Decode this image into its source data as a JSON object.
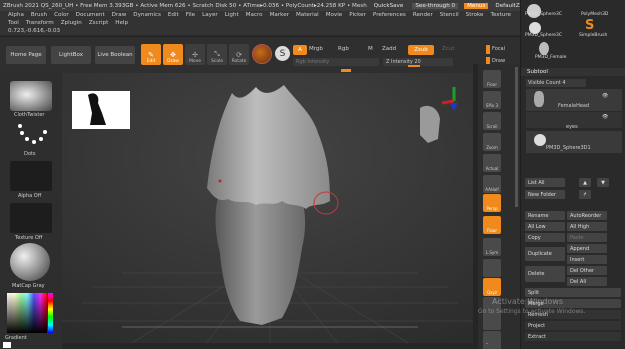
{
  "window": {
    "title": "ZBrush 2021   QS_260_UH  • Free Mem 3.393GB • Active Mem 626 • Scratch Disk 50 • ATime▸0.036 • PolyCount▸24.258 KP • Mesh",
    "quicksave": "QuickSave",
    "see_through": "See-through  0",
    "menus_label": "Menus",
    "default_script": "DefaultZScript"
  },
  "menu": {
    "row1": [
      "Alpha",
      "Brush",
      "Color",
      "Document",
      "Draw",
      "Dynamics",
      "Edit",
      "File",
      "Layer",
      "Light",
      "Macro",
      "Marker",
      "Material",
      "Movie",
      "Picker",
      "Preferences",
      "Render",
      "Stencil",
      "Stroke",
      "Texture"
    ],
    "row2": [
      "Tool",
      "Transform",
      "Zplugin",
      "Zscript",
      "Help"
    ],
    "coords": "0.723,-0.616,-0.03"
  },
  "toolbar": {
    "home_page": "Home Page",
    "lightbox": "LightBox",
    "live_boolean": "Live Boolean",
    "edit": "Edit",
    "draw": "Draw",
    "move": "Move",
    "scale": "Scale",
    "rotate": "Rotate",
    "a_label": "A",
    "mrgb": "Mrgb",
    "rgb": "Rgb",
    "m": "M",
    "zadd": "Zadd",
    "zsub": "Zsub",
    "zcut": "Zcut",
    "rgb_intensity": "Rgb Intensity",
    "z_intensity": "Z Intensity 20",
    "focal": "Focal",
    "draw_size": "Draw"
  },
  "left_shelf": {
    "brush": "ClothTwister",
    "stroke": "Dots",
    "alpha": "Alpha Off",
    "texture": "Texture Off",
    "material": "MatCap Gray",
    "gradient": "Gradient"
  },
  "right_shelf": {
    "buttons": [
      "Floor",
      "SPix 3",
      "Scroll",
      "Zoom",
      "Actual",
      "AAHalf",
      "Persp",
      "Floor",
      "L.Sym",
      "",
      "Qxyz",
      "",
      "",
      "Frame",
      "Move"
    ]
  },
  "tray": {
    "thumbs": [
      "PM3D_Sphere3C",
      "PolyMesh3D",
      "PM3D_Sphere3C",
      "SimpleBrush",
      "PM3D_Female"
    ],
    "subtool_title": "Subtool",
    "visible_count": "Visible Count 4",
    "subtools": [
      "FemaleHead",
      "eyes",
      "PM3D_Sphere3D1"
    ],
    "list_all": "List All",
    "new_folder": "New Folder",
    "rename": "Rename",
    "auto_reorder": "AutoReorder",
    "all_low": "All Low",
    "all_high": "All High",
    "copy": "Copy",
    "paste": "Paste",
    "append": "Append",
    "duplicate": "Duplicate",
    "insert": "Insert",
    "delete": "Delete",
    "del_other": "Del Other",
    "del_all": "Del All",
    "split": "Split",
    "merge": "Merge",
    "remesh": "Remesh",
    "project": "Project",
    "extract": "Extract"
  },
  "watermark": {
    "line1": "Activate Windows",
    "line2": "Go to Settings to activate Windows."
  },
  "colors": {
    "accent": "#f08a1c",
    "panel": "#2b2b2b",
    "canvas": "#3a3a3a"
  }
}
